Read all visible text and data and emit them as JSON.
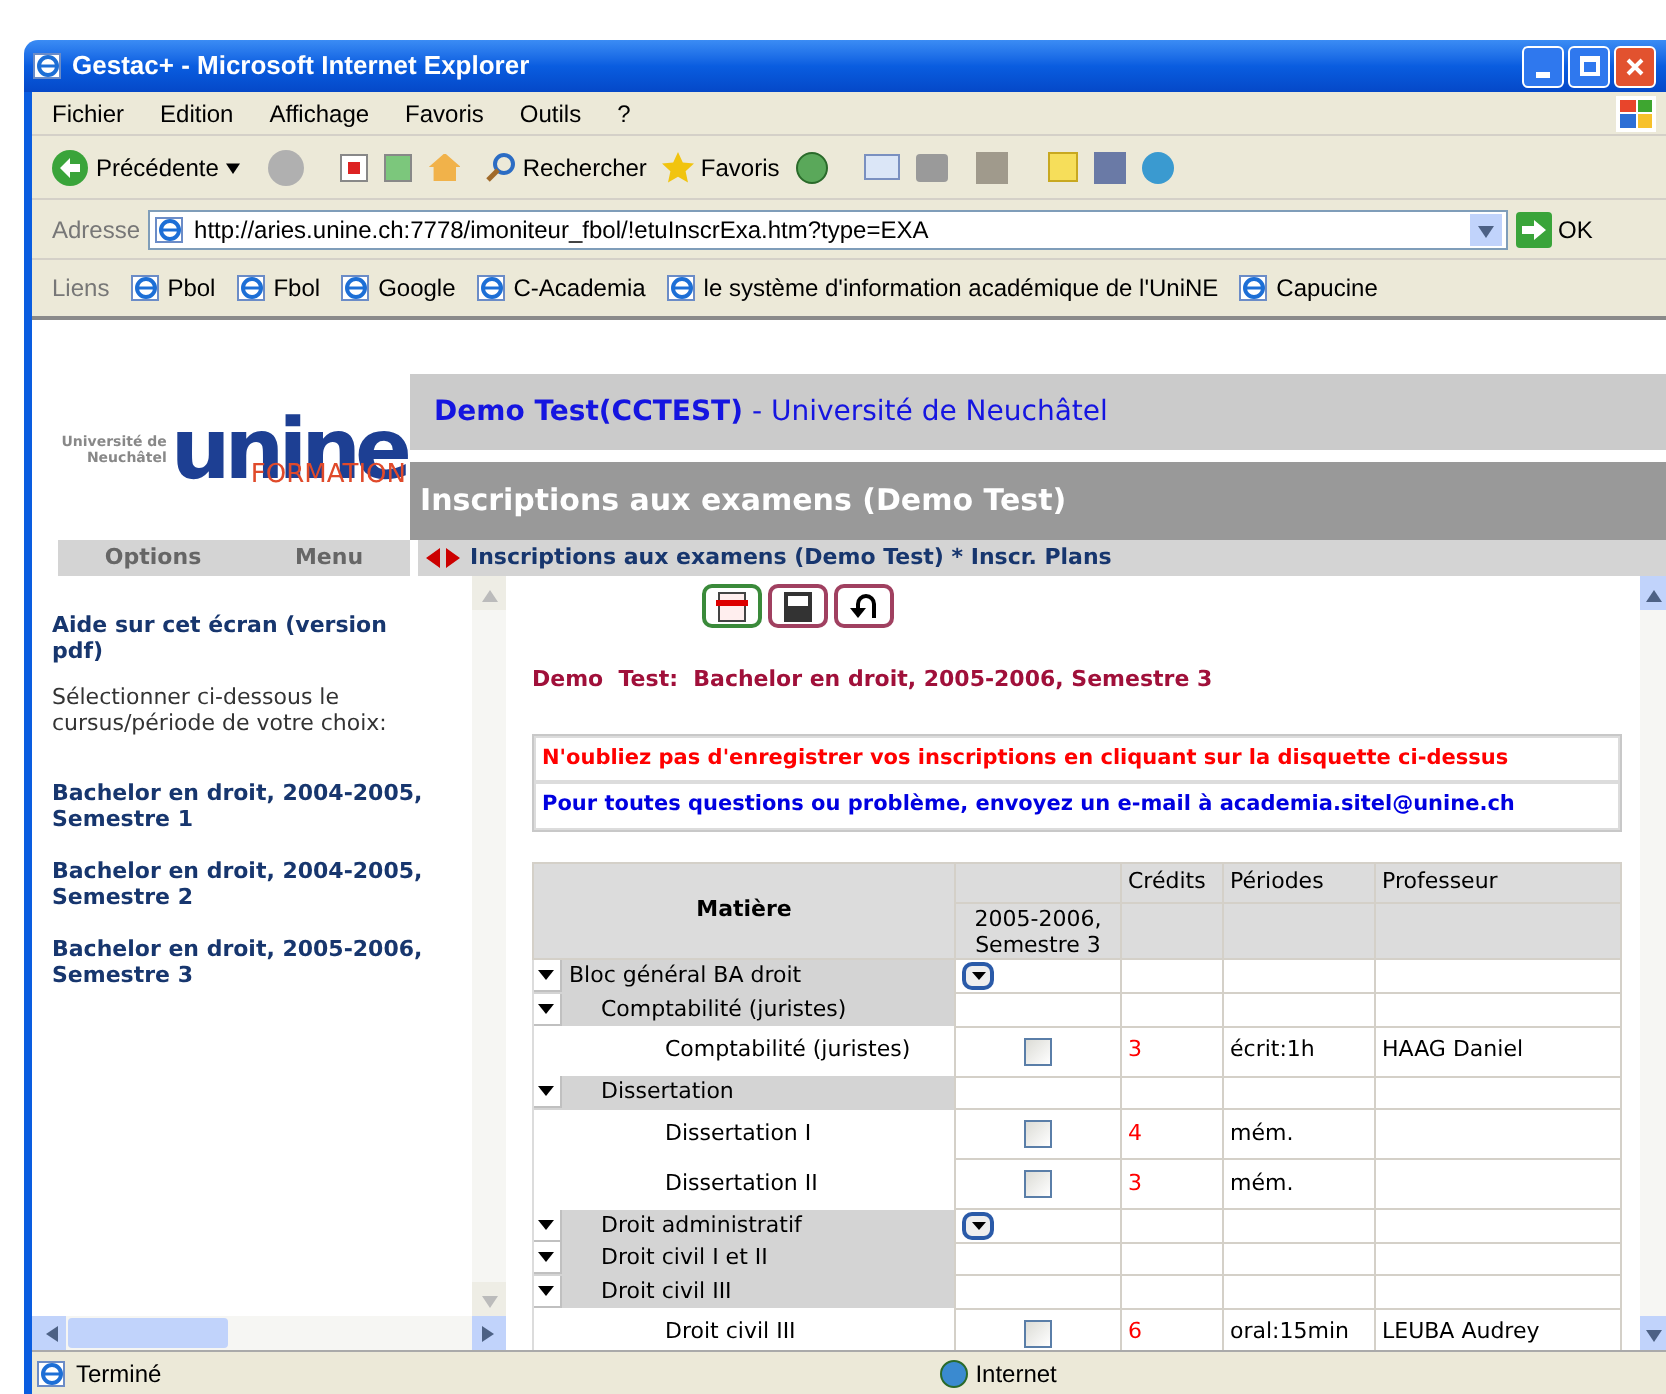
{
  "window": {
    "title": "Gestac+ - Microsoft Internet Explorer"
  },
  "menu": [
    "Fichier",
    "Edition",
    "Affichage",
    "Favoris",
    "Outils",
    "?"
  ],
  "toolbar": {
    "back": "Précédente",
    "search": "Rechercher",
    "favorites": "Favoris"
  },
  "address": {
    "label": "Adresse",
    "value": "http://aries.unine.ch:7778/imoniteur_fbol/!etuInscrExa.htm?type=EXA",
    "go": "OK"
  },
  "links": {
    "label": "Liens",
    "items": [
      "Pbol",
      "Fbol",
      "Google",
      "C-Academia",
      "le système d'information académique de l'UniNE",
      "Capucine"
    ]
  },
  "logo": {
    "university": "Université de Neuchâtel",
    "mark": "unine",
    "tagline": "FORMATION"
  },
  "header": {
    "title": "**Demo Test(CCTEST)** - Université de Neuchâtel",
    "section": "Inscriptions aux examens (Demo Test)"
  },
  "left_tabs": [
    "Options",
    "Menu"
  ],
  "breadcrumb": "Inscriptions aux examens (Demo Test) * Inscr. Plans",
  "sidebar": {
    "help_link": "Aide sur cet écran (version pdf)",
    "instruction": "Sélectionner ci-dessous le cursus/période de votre choix:",
    "items": [
      "Bachelor en droit, 2004-2005, Semestre 1",
      "Bachelor en droit, 2004-2005, Semestre 2",
      "Bachelor en droit, 2005-2006, Semestre 3"
    ]
  },
  "main": {
    "heading": "Demo  Test:  Bachelor en droit, 2005-2006, Semestre 3",
    "notices": [
      {
        "kind": "warning",
        "text": "N'oubliez pas d'enregistrer vos inscriptions en cliquant sur la disquette ci-dessus"
      },
      {
        "kind": "info",
        "text": "Pour toutes questions ou problème, envoyez un e-mail à academia.sitel@unine.ch"
      }
    ],
    "table": {
      "columns": {
        "subject": "Matière",
        "semester": "2005-2006, Semestre 3",
        "credits": "Crédits",
        "periods": "Périodes",
        "professor": "Professeur"
      },
      "rows": [
        {
          "kind": "group",
          "label": "Bloc général BA droit",
          "menu_button": true,
          "children": [
            {
              "kind": "group",
              "label": "Comptabilité (juristes)",
              "menu_button": false,
              "children": [
                {
                  "kind": "course",
                  "label": "Comptabilité (juristes)",
                  "checked": false,
                  "credits": "3",
                  "periods": "écrit:1h",
                  "professor": "HAAG Daniel"
                }
              ]
            },
            {
              "kind": "group",
              "label": "Dissertation",
              "menu_button": false,
              "children": [
                {
                  "kind": "course",
                  "label": "Dissertation I",
                  "checked": false,
                  "credits": "4",
                  "periods": "mém."
                },
                {
                  "kind": "course",
                  "label": "Dissertation II",
                  "checked": false,
                  "credits": "3",
                  "periods": "mém."
                }
              ]
            },
            {
              "kind": "group",
              "label": "Droit administratif",
              "menu_button": true
            },
            {
              "kind": "group",
              "label": "Droit civil I et II",
              "menu_button": false
            },
            {
              "kind": "group",
              "label": "Droit civil III",
              "menu_button": false,
              "children": [
                {
                  "kind": "course",
                  "label": "Droit civil III",
                  "checked": false,
                  "credits": "6",
                  "periods": "oral:15min",
                  "professor": "LEUBA Audrey"
                }
              ]
            }
          ]
        }
      ]
    }
  },
  "status_bar": {
    "text": "Terminé",
    "zone": "Internet"
  }
}
